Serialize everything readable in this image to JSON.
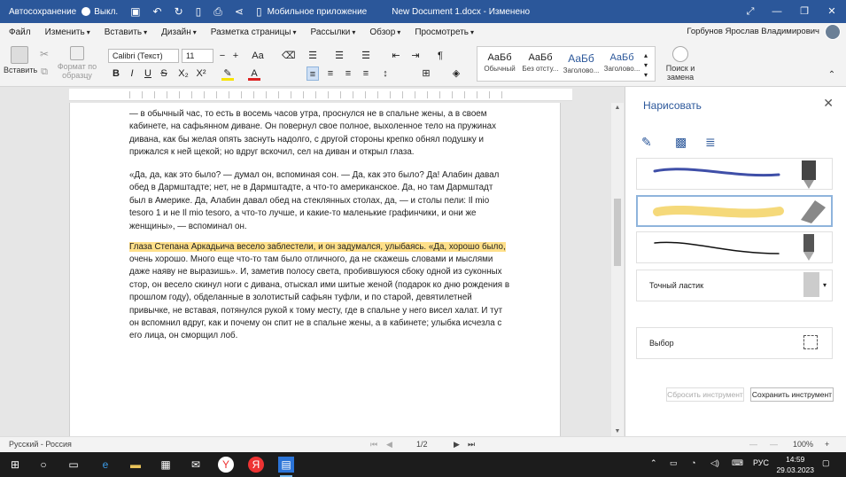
{
  "titlebar": {
    "autosave_label": "Автосохранение",
    "autosave_state": "Выкл.",
    "mobile_app_label": "Мобильное приложение",
    "document_title": "New Document 1.docx - Изменено"
  },
  "menu": {
    "items": [
      "Файл",
      "Изменить",
      "Вставить",
      "Дизайн",
      "Разметка страницы",
      "Рассылки",
      "Обзор",
      "Просмотреть"
    ],
    "user_name": "Горбунов Ярослав Владимирович"
  },
  "ribbon": {
    "paste_label": "Вставить",
    "format_painter_label": "Формат по образцу",
    "font_name": "Calibri (Текст)",
    "font_size": "11",
    "styles": [
      {
        "sample": "АаБб",
        "name": "Обычный"
      },
      {
        "sample": "АаБб",
        "name": "Без отсту..."
      },
      {
        "sample": "АаБб",
        "name": "Заголово..."
      },
      {
        "sample": "АаБб",
        "name": "Заголово..."
      }
    ],
    "find_replace_label": "Поиск и замена"
  },
  "document": {
    "paragraphs": [
      "— в обычный час, то есть в восемь часов утра, проснулся не в спальне жены, а в своем кабинете, на сафьянном диване. Он повернул свое полное, выхоленное тело на пружинах дивана, как бы желая опять заснуть надолго, с другой стороны крепко обнял подушку и прижался к ней щекой; но вдруг вскочил, сел на диван и открыл глаза.",
      "«Да, да, как это было? — думал он, вспоминая сон. — Да, как это было? Да! Алабин давал обед в Дармштадте; нет, не в Дармштадте, а что-то американское. Да, но там Дармштадт был в Америке. Да, Алабин давал обед на стеклянных столах, да, — и столы пели: Il mio tesoro 1 и не Il mio tesoro, а что-то лучше, и какие-то маленькие графинчики, и они же женщины», — вспоминал он.",
      "Глаза Степана Аркадьича весело заблестели, и он задумался, улыбаясь. «Да, хорошо было,",
      "очень хорошо. Много еще что-то там было отличного, да не скажешь словами и мыслями даже наяву не выразишь». И, заметив полосу света, пробившуюся сбоку одной из суконных стор, он весело скинул ноги с дивана, отыскал ими шитые женой (подарок ко дню рождения в прошлом году), обделанные в золотистый сафьян туфли, и по старой, девятилетней привычке, не вставая, потянулся рукой к тому месту, где в спальне у него висел халат. И тут он вспомнил вдруг, как и почему он спит не в спальне жены, а в кабинете; улыбка исчезла с его лица, он сморщил лоб."
    ]
  },
  "draw_pane": {
    "title": "Нарисовать",
    "pens": [
      {
        "color": "#3f4fa8"
      },
      {
        "color": "#f5d97a"
      },
      {
        "color": "#111111"
      }
    ],
    "eraser_label": "Точный ластик",
    "selection_label": "Выбор",
    "reset_button": "Сбросить инструмент",
    "save_button": "Сохранить инструмент"
  },
  "statusbar": {
    "language": "Русский - Россия",
    "page_indicator": "1/2",
    "zoom": "100%"
  },
  "taskbar": {
    "language": "РУС",
    "time": "14:59",
    "date": "29.03.2023"
  },
  "colors": {
    "accent": "#2b579a",
    "highlight": "#ffe08a"
  }
}
